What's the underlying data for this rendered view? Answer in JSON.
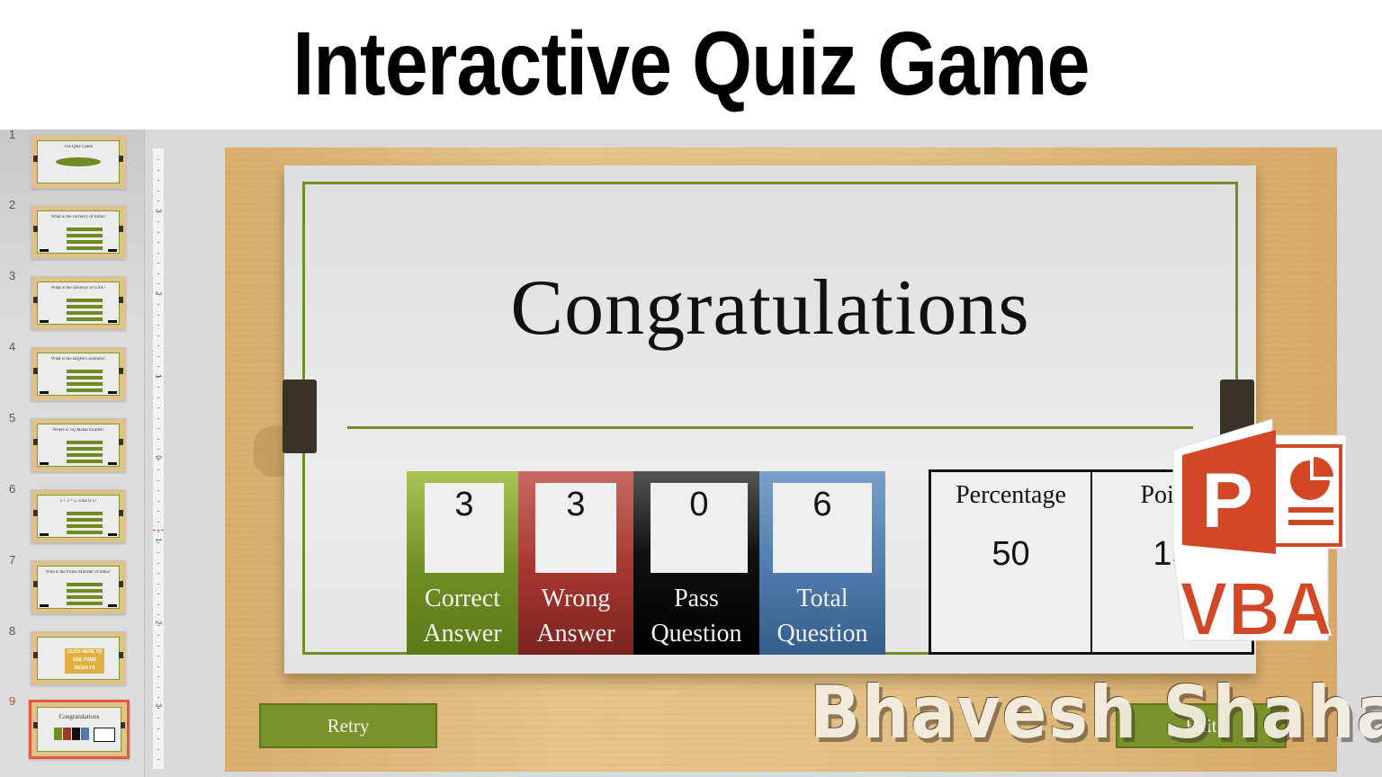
{
  "banner": {
    "title": "Interactive Quiz Game"
  },
  "thumbnails": [
    {
      "num": "1",
      "kind": "title",
      "text": "The Quiz Game"
    },
    {
      "num": "2",
      "kind": "question",
      "text": "What is the currency of India?"
    },
    {
      "num": "3",
      "kind": "question",
      "text": "What is the currency of USA?"
    },
    {
      "num": "4",
      "kind": "question",
      "text": "What is the largest Continent?"
    },
    {
      "num": "5",
      "kind": "question",
      "text": "Where is Taj Mahal located?"
    },
    {
      "num": "6",
      "kind": "question",
      "text": "x + 3 = 5, what is x?"
    },
    {
      "num": "7",
      "kind": "question",
      "text": "Who is the Prime Minister of India?"
    },
    {
      "num": "8",
      "kind": "cta",
      "text": "CLICK HERE TO SEE YOUR RESULTS"
    },
    {
      "num": "9",
      "kind": "results",
      "text": "Congratulations",
      "active": true
    }
  ],
  "ruler": {
    "labels": [
      "3",
      "2",
      "1",
      "0",
      "1",
      "2",
      "3"
    ]
  },
  "slide": {
    "title": "Congratulations",
    "stats": [
      {
        "label_1": "Correct",
        "label_2": "Answer",
        "value": "3",
        "color": "#6f8e23"
      },
      {
        "label_1": "Wrong",
        "label_2": "Answer",
        "value": "3",
        "color": "#a5362f"
      },
      {
        "label_1": "Pass",
        "label_2": "Question",
        "value": "0",
        "color": "#111111"
      },
      {
        "label_1": "Total",
        "label_2": "Question",
        "value": "6",
        "color": "#4f7aab"
      }
    ],
    "results": [
      {
        "label": "Percentage",
        "value": "50"
      },
      {
        "label": "Points",
        "value": "15"
      }
    ],
    "retry_label": "Retry",
    "exit_label": "Exit"
  },
  "overlay": {
    "logo_letter": "P",
    "logo_text": "VBA",
    "logo_color": "#d24726",
    "watermark": "Bhavesh Shaha"
  }
}
